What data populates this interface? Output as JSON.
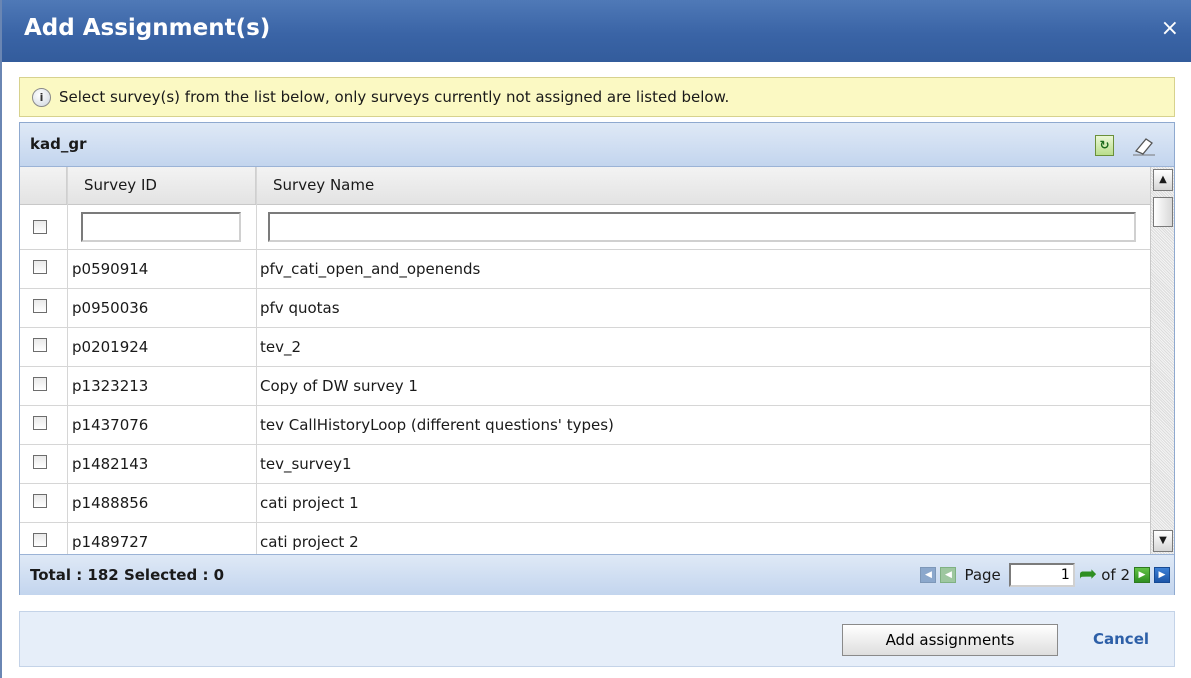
{
  "dialog": {
    "title": "Add Assignment(s)",
    "close_glyph": "×"
  },
  "info": {
    "icon": "info-icon",
    "message": "Select survey(s) from the list below, only surveys currently not assigned are listed below."
  },
  "grid": {
    "title": "kad_gr",
    "toolbar": {
      "refresh_icon": "refresh-icon",
      "clear_icon": "eraser-icon"
    },
    "columns": {
      "id": "Survey ID",
      "name": "Survey Name"
    },
    "filters": {
      "id_value": "",
      "name_value": ""
    },
    "rows": [
      {
        "id": "p0590914",
        "name": "pfv_cati_open_and_openends"
      },
      {
        "id": "p0950036",
        "name": "pfv quotas"
      },
      {
        "id": "p0201924",
        "name": "tev_2"
      },
      {
        "id": "p1323213",
        "name": "Copy of DW survey 1"
      },
      {
        "id": "p1437076",
        "name": "tev CallHistoryLoop (different questions' types)"
      },
      {
        "id": "p1482143",
        "name": "tev_survey1"
      },
      {
        "id": "p1488856",
        "name": "cati project 1"
      },
      {
        "id": "p1489727",
        "name": "cati project 2"
      }
    ],
    "footer": {
      "summary": "Total : 182 Selected : 0",
      "page_label": "Page",
      "page_value": "1",
      "of_label": "of 2"
    }
  },
  "actions": {
    "add_label": "Add assignments",
    "cancel_label": "Cancel"
  },
  "colors": {
    "titlebar": "#3a64a6",
    "info_bg": "#fbf9c3",
    "header_bg": "#c3d5ee",
    "link": "#2d5fa8"
  }
}
